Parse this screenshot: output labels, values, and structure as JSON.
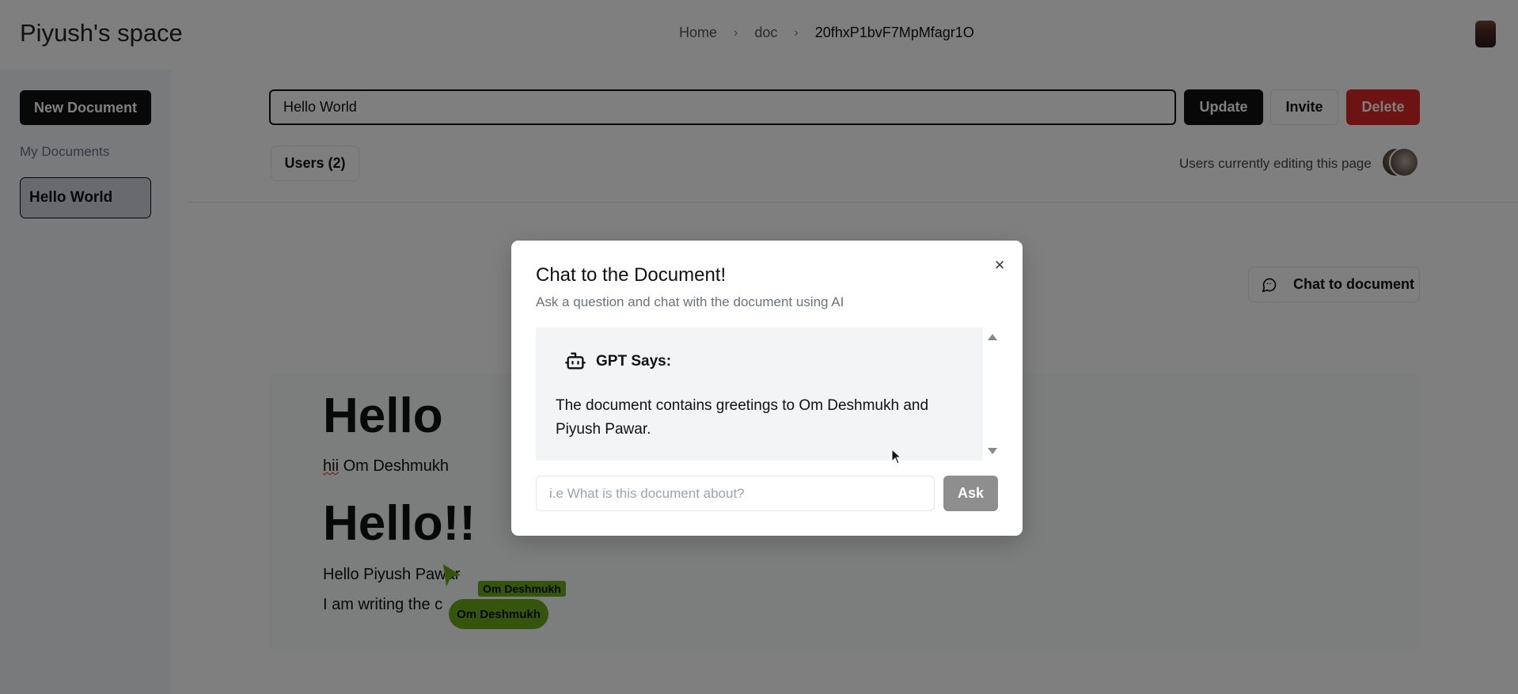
{
  "header": {
    "app_title": "Piyush's space",
    "breadcrumb": [
      "Home",
      "doc",
      "20fhxP1bvF7MpMfagr1O"
    ]
  },
  "sidebar": {
    "new_document_label": "New Document",
    "my_documents_label": "My Documents",
    "documents": [
      "Hello World"
    ]
  },
  "document": {
    "title_value": "Hello World",
    "update_label": "Update",
    "invite_label": "Invite",
    "delete_label": "Delete",
    "users_label": "Users (2)",
    "editing_label": "Users currently editing this page",
    "chat_to_document_label": "Chat to document"
  },
  "editor": {
    "heading_1": "Hello",
    "para_1_misspelled": "hii",
    "para_1_rest": " Om Deshmukh",
    "heading_2": "Hello!!",
    "para_2": "Hello Piyush Pawar",
    "para_3": "I am writing the c",
    "cursor_tag": "Om Deshmukh",
    "cursor_pill": "Om Deshmukh"
  },
  "modal": {
    "title": "Chat to the Document!",
    "description": "Ask a question and chat with the document using AI",
    "gpt_label": "GPT Says:",
    "gpt_answer": "The document contains greetings to Om Deshmukh and Piyush Pawar.",
    "ask_placeholder": "i.e What is this document about?",
    "ask_label": "Ask",
    "close_glyph": "×"
  },
  "colors": {
    "primary": "#111111",
    "danger": "#dc2626",
    "collab_green": "#6aaa1a",
    "ask_disabled": "#8e8e8e"
  }
}
